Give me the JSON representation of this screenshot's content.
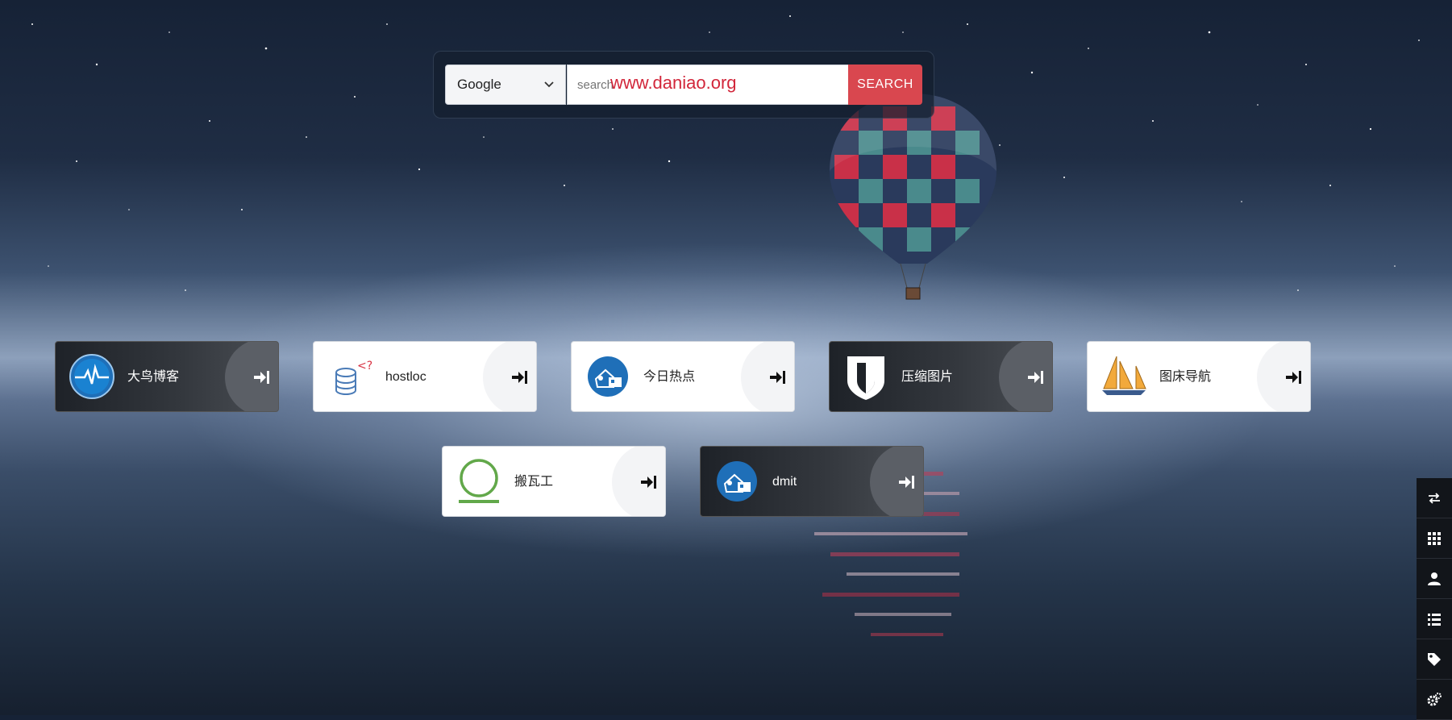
{
  "search": {
    "engine_selected": "Google",
    "placeholder": "search",
    "button_label": "SEARCH",
    "watermark": "www.daniao.org"
  },
  "links": [
    {
      "label": "大鸟博客",
      "theme": "dark",
      "icon": "heartbeat-circle-icon"
    },
    {
      "label": "hostloc",
      "theme": "light",
      "icon": "database-code-icon"
    },
    {
      "label": "今日热点",
      "theme": "light",
      "icon": "house-tag-icon"
    },
    {
      "label": "压缩图片",
      "theme": "dark",
      "icon": "shield-icon"
    },
    {
      "label": "图床导航",
      "theme": "light",
      "icon": "sailboat-icon"
    },
    {
      "label": "搬瓦工",
      "theme": "light",
      "icon": "green-ring-icon"
    },
    {
      "label": "dmit",
      "theme": "dark",
      "icon": "house-tag-icon"
    }
  ],
  "side_toolbar": [
    {
      "icon": "swap-icon"
    },
    {
      "icon": "grid-icon"
    },
    {
      "icon": "user-icon"
    },
    {
      "icon": "list-icon"
    },
    {
      "icon": "tag-icon"
    },
    {
      "icon": "cogs-icon"
    }
  ],
  "colors": {
    "search_button": "#d9474f",
    "watermark": "#d2263a",
    "card_dark": "#2b2f35",
    "card_light": "#ffffff"
  }
}
